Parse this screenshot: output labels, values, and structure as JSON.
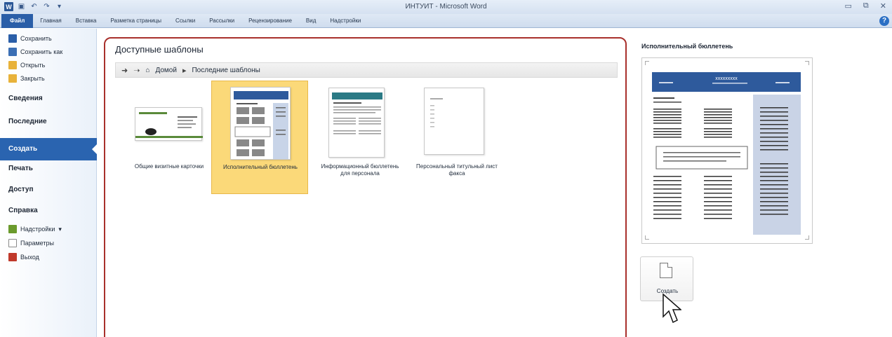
{
  "window": {
    "title": "ИНТУИТ - Microsoft Word"
  },
  "quick_access": {
    "icons": [
      "word-icon",
      "save-icon",
      "undo-icon",
      "redo-icon",
      "customize-icon"
    ]
  },
  "ribbon_tabs": [
    "Файл",
    "Главная",
    "Вставка",
    "Разметка страницы",
    "Ссылки",
    "Рассылки",
    "Рецензирование",
    "Вид",
    "Надстройки"
  ],
  "nav": {
    "items": [
      {
        "label": "Сохранить",
        "icon": "save-icon",
        "color": "#2a5ea8"
      },
      {
        "label": "Сохранить как",
        "icon": "save-as-icon",
        "color": "#3b6fb5"
      },
      {
        "label": "Открыть",
        "icon": "open-folder-icon",
        "color": "#e8b23a"
      },
      {
        "label": "Закрыть",
        "icon": "close-folder-icon",
        "color": "#e8b23a"
      }
    ],
    "sections": [
      "Сведения",
      "Последние",
      "Создать",
      "Печать",
      "Доступ",
      "Справка"
    ],
    "selected": "Создать",
    "tools": [
      {
        "label": "Надстройки",
        "icon": "addins-icon",
        "color": "#6a9a2c"
      },
      {
        "label": "Параметры",
        "icon": "options-icon",
        "color": "#8a8a8a"
      },
      {
        "label": "Выход",
        "icon": "exit-icon",
        "color": "#c0392b"
      }
    ]
  },
  "templates_panel": {
    "title": "Доступные шаблоны",
    "breadcrumb": {
      "home": "Домой",
      "current": "Последние шаблоны"
    },
    "templates": [
      {
        "label": "Общие визитные карточки"
      },
      {
        "label": "Исполнительный бюллетень"
      },
      {
        "label": "Информационный бюллетень для персонала"
      },
      {
        "label": "Персональный титульный лист факса"
      }
    ],
    "selected_index": 1
  },
  "preview": {
    "title": "Исполнительный бюллетень",
    "header_text": "xxxxxxxxx"
  },
  "create_button": {
    "label": "Создать"
  },
  "colors": {
    "file_tab": "#2a5ea8",
    "nav_selected": "#2a64b0",
    "panel_border": "#a8302c",
    "selected_template": "#fbd979",
    "newsletter_blue": "#2e5a9c"
  }
}
